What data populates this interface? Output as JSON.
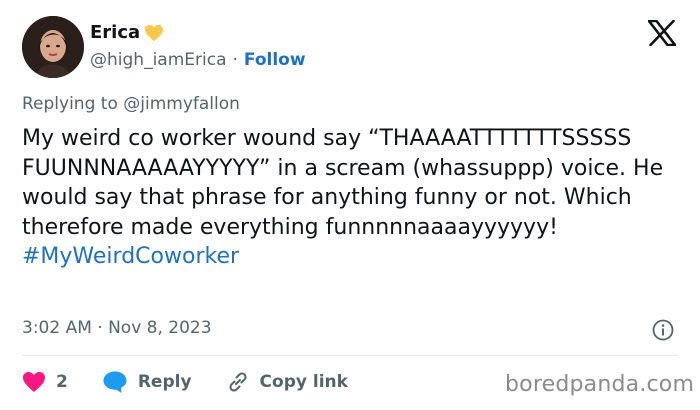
{
  "author": {
    "name": "Erica",
    "handle": "@high_iamErica",
    "separator": "·",
    "follow_label": "Follow",
    "heart_color": "#f6c84b"
  },
  "reply_context": {
    "prefix": "Replying to",
    "mention": "@jimmyfallon"
  },
  "tweet": {
    "text": "My weird co worker wound say “THAAAATTTTTTTSSSSS FUUNNNAAAAAYYYYY” in a scream (whassuppp) voice. He would say that phrase for anything funny or not. Which therefore made everything funnnnnaaaayyyyyy!",
    "hashtag": "#MyWeirdCoworker",
    "timestamp": "3:02 AM · Nov 8, 2023"
  },
  "actions": {
    "like_count": "2",
    "reply_label": "Reply",
    "copy_label": "Copy link"
  },
  "watermark": "boredpanda.com",
  "colors": {
    "link": "#1d70c7",
    "like": "#f91880",
    "reply": "#1d9bf0",
    "muted": "#536471"
  },
  "icons": [
    "x-logo-icon",
    "heart-emoji-icon",
    "info-icon",
    "like-heart-icon",
    "reply-bubble-icon",
    "link-icon"
  ]
}
